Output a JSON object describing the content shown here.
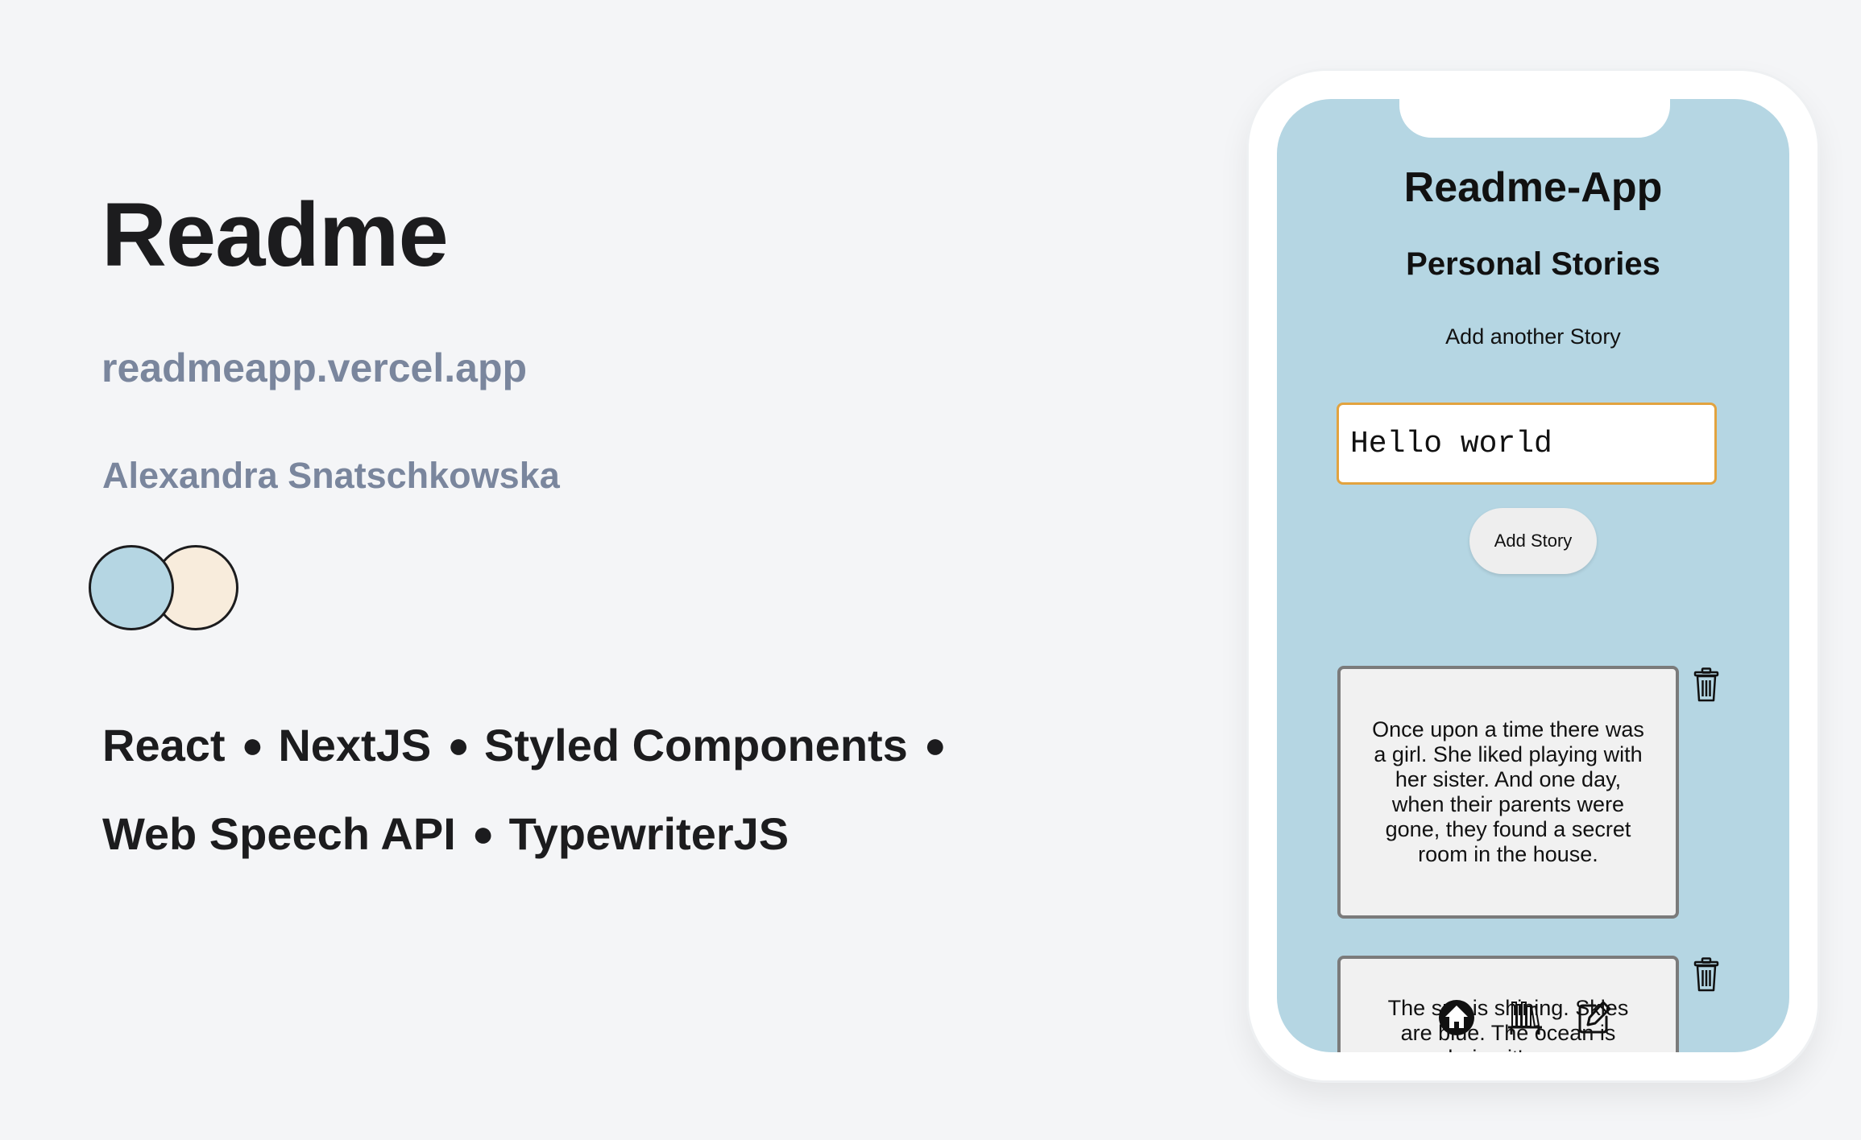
{
  "project": {
    "title": "Readme",
    "link": "readmeapp.vercel.app",
    "author": "Alexandra Snatschkowska",
    "palette": [
      "#b5d6e3",
      "#f8ecdc"
    ],
    "tech_line_1": [
      "React",
      "NextJS",
      "Styled Components"
    ],
    "tech_line_2": [
      "Web Speech API",
      "TypewriterJS"
    ],
    "separator": "●"
  },
  "app": {
    "title": "Readme-App",
    "subtitle": "Personal Stories",
    "add_label": "Add another Story",
    "input_value": "Hello world",
    "add_button_label": "Add Story",
    "stories": [
      {
        "text": "Once upon a time there was a girl. She liked playing with her sister. And one day, when their parents were gone, they found a secret room in the house."
      },
      {
        "text": "The sun is shining. Skies are blue. The ocean is rendering it's waves."
      }
    ],
    "nav": [
      {
        "icon": "home-icon"
      },
      {
        "icon": "bookshelf-icon"
      },
      {
        "icon": "edit-note-icon"
      }
    ],
    "colors": {
      "screen_bg": "#b5d6e3",
      "input_border": "#e2a33f",
      "card_bg": "#f1f1f1",
      "card_border": "#7b7b7b"
    }
  }
}
